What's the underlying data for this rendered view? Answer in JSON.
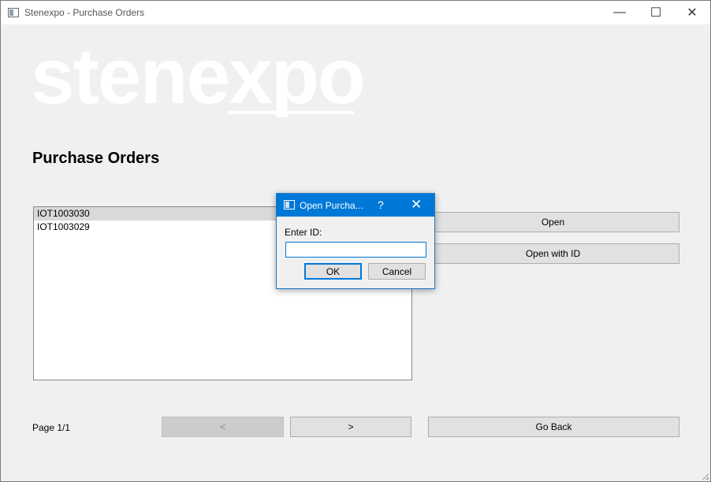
{
  "window": {
    "title": "Stenexpo - Purchase Orders",
    "controls": {
      "minimize": "—",
      "maximize": "☐",
      "close": "✕"
    }
  },
  "logo": {
    "part1": "sten",
    "part2": "expo",
    "color": "#ffffff"
  },
  "main": {
    "page_title": "Purchase Orders",
    "orders": [
      {
        "id": "IOT1003030",
        "selected": true
      },
      {
        "id": "IOT1003029",
        "selected": false
      }
    ],
    "open_button": "Open",
    "open_with_id_button": "Open with ID",
    "page_label": "Page 1/1",
    "prev_button": "<",
    "next_button": ">",
    "go_back_button": "Go Back"
  },
  "dialog": {
    "title": "Open Purcha...",
    "help": "?",
    "close": "✕",
    "label": "Enter ID:",
    "input_value": "",
    "ok_button": "OK",
    "cancel_button": "Cancel"
  },
  "colors": {
    "accent": "#0078d7",
    "background": "#f0f0f0",
    "selection": "#d9d9d9"
  }
}
